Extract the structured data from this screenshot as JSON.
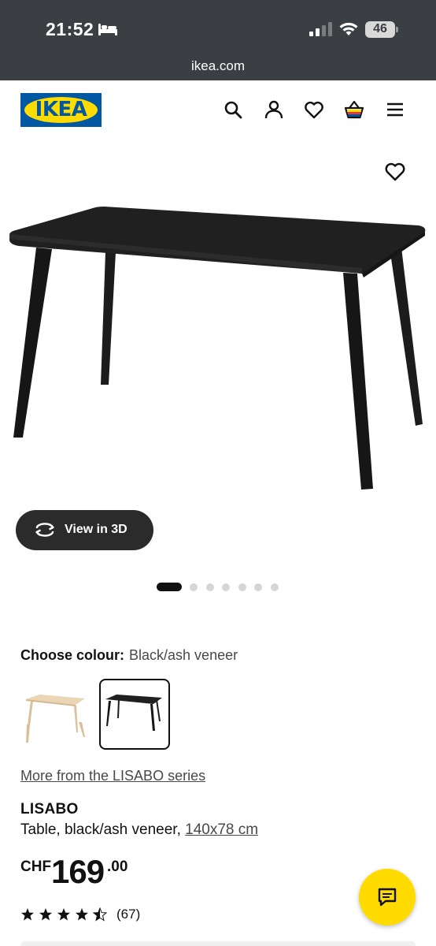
{
  "status_bar": {
    "time": "21:52",
    "focus_icon": "bed-icon",
    "battery": "46"
  },
  "browser": {
    "url": "ikea.com"
  },
  "header": {
    "logo_text": "IKEA",
    "icons": [
      "search-icon",
      "account-icon",
      "heart-icon",
      "cart-icon",
      "menu-icon"
    ]
  },
  "product_gallery": {
    "view_3d_label": "View in 3D",
    "dots_total": 7,
    "dot_active_index": 0
  },
  "colour": {
    "label": "Choose colour:",
    "selected_value": "Black/ash veneer",
    "options": [
      "natural-ash-swatch",
      "black-ash-swatch"
    ]
  },
  "product": {
    "series_link": "More from the LISABO series",
    "name": "LISABO",
    "description": "Table, black/ash veneer, ",
    "size_link": "140x78 cm",
    "price_currency": "CHF",
    "price_integer": "169",
    "price_decimal": ".00",
    "rating_stars": 4.5,
    "rating_count": "(67)"
  },
  "colors": {
    "ikea_blue": "#0058a3",
    "ikea_yellow": "#ffdb00",
    "chrome_dark": "#3b3e42"
  }
}
